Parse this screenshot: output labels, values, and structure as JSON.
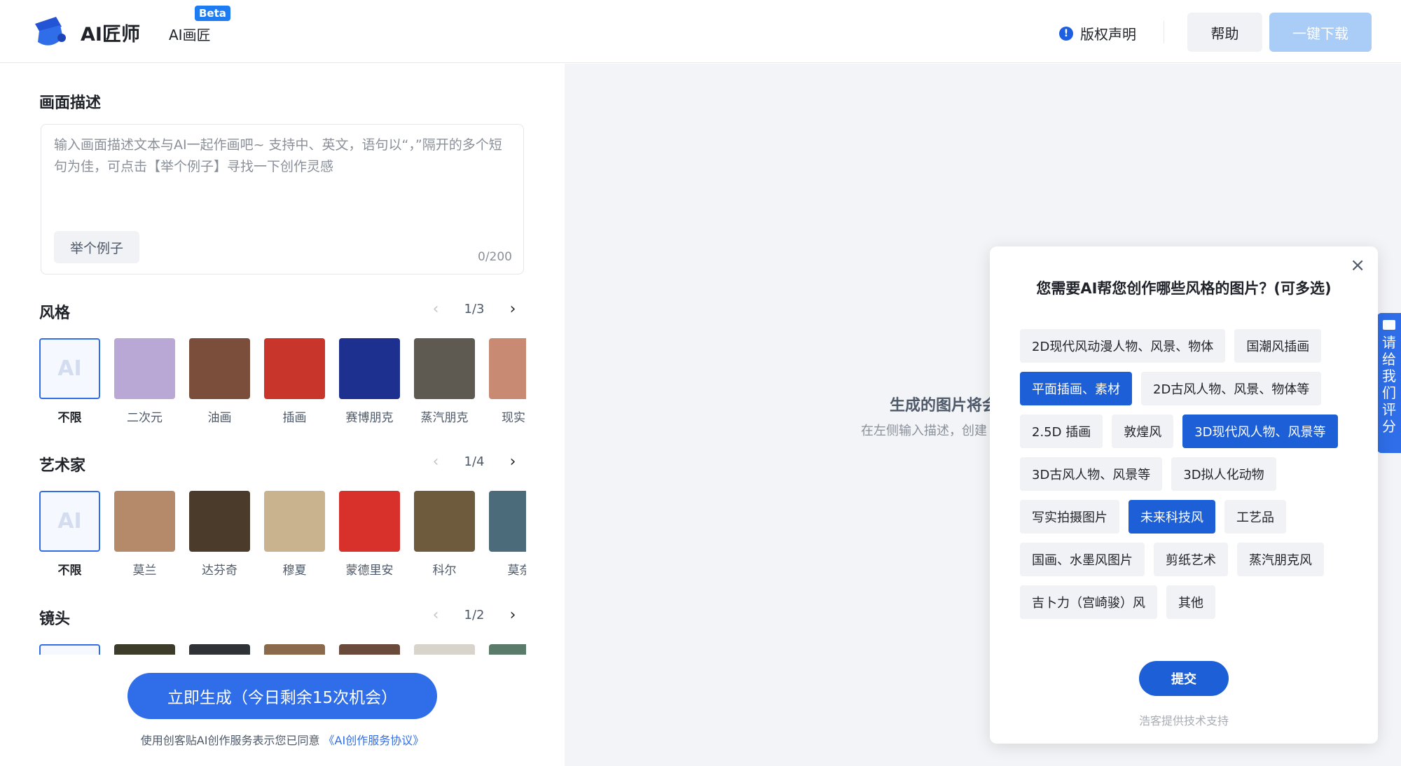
{
  "header": {
    "brand": "AI匠师",
    "nav_item": "AI画匠",
    "beta_badge": "Beta",
    "copyright_label": "版权声明",
    "help_label": "帮助",
    "download_label": "一键下载"
  },
  "description": {
    "title": "画面描述",
    "placeholder": "输入画面描述文本与AI一起作画吧~ 支持中、英文，语句以“，”隔开的多个短句为佳，可点击【举个例子】寻找一下创作灵感",
    "example_label": "举个例子",
    "char_count": "0/200"
  },
  "style_section": {
    "title": "风格",
    "page": "1/3",
    "items": [
      {
        "label": "不限",
        "selected": true,
        "color": "#f5f8ff"
      },
      {
        "label": "二次元",
        "color": "#b9a7d6"
      },
      {
        "label": "油画",
        "color": "#7a4e3a"
      },
      {
        "label": "插画",
        "color": "#c8362b"
      },
      {
        "label": "赛博朋克",
        "color": "#1d2f8f"
      },
      {
        "label": "蒸汽朋克",
        "color": "#5e5a52"
      },
      {
        "label": "现实照",
        "color": "#c98a73"
      }
    ]
  },
  "artist_section": {
    "title": "艺术家",
    "page": "1/4",
    "items": [
      {
        "label": "不限",
        "selected": true,
        "color": "#f5f8ff"
      },
      {
        "label": "莫兰",
        "color": "#b58a6a"
      },
      {
        "label": "达芬奇",
        "color": "#4b3b2a"
      },
      {
        "label": "穆夏",
        "color": "#c9b28e"
      },
      {
        "label": "蒙德里安",
        "color": "#d8302a"
      },
      {
        "label": "科尔",
        "color": "#6e5a3c"
      },
      {
        "label": "莫奈",
        "color": "#4c6b7a"
      }
    ]
  },
  "lens_section": {
    "title": "镜头",
    "page": "1/2",
    "items": [
      {
        "selected": true,
        "color": "#f5f8ff"
      },
      {
        "color": "#3d3b2a"
      },
      {
        "color": "#2f3338"
      },
      {
        "color": "#8a6a4a"
      },
      {
        "color": "#6a4a3a"
      },
      {
        "color": "#d8d4cc"
      },
      {
        "color": "#5a7a6a"
      }
    ]
  },
  "generate_label": "立即生成（今日剩余15次机会）",
  "agreement": {
    "prefix": "使用创客贴AI创作服务表示您已同意",
    "link": "《AI创作服务协议》"
  },
  "result_area": {
    "title": "生成的图片将会",
    "subtitle": "在左侧输入描述，创建"
  },
  "rate_tab": "请给我们评分",
  "modal": {
    "title": "您需要AI帮您创作哪些风格的图片？(可多选)",
    "options": [
      {
        "label": "2D现代风动漫人物、风景、物体",
        "selected": false
      },
      {
        "label": "国潮风插画",
        "selected": false
      },
      {
        "label": "平面插画、素材",
        "selected": true
      },
      {
        "label": "2D古风人物、风景、物体等",
        "selected": false
      },
      {
        "label": "2.5D 插画",
        "selected": false
      },
      {
        "label": "敦煌风",
        "selected": false
      },
      {
        "label": "3D现代风人物、风景等",
        "selected": true
      },
      {
        "label": "3D古风人物、风景等",
        "selected": false
      },
      {
        "label": "3D拟人化动物",
        "selected": false
      },
      {
        "label": "写实拍摄图片",
        "selected": false
      },
      {
        "label": "未来科技风",
        "selected": true
      },
      {
        "label": "工艺品",
        "selected": false
      },
      {
        "label": "国画、水墨风图片",
        "selected": false
      },
      {
        "label": "剪纸艺术",
        "selected": false
      },
      {
        "label": "蒸汽朋克风",
        "selected": false
      },
      {
        "label": "吉卜力（宫崎骏）风",
        "selected": false
      },
      {
        "label": "其他",
        "selected": false
      }
    ],
    "submit_label": "提交",
    "footer": "浩客提供技术支持"
  },
  "colors": {
    "accent": "#2f6ee8",
    "chip_selected": "#1d5fd6",
    "download_disabled": "#a9cdf6",
    "canvas_bg": "#f3f4f7"
  }
}
